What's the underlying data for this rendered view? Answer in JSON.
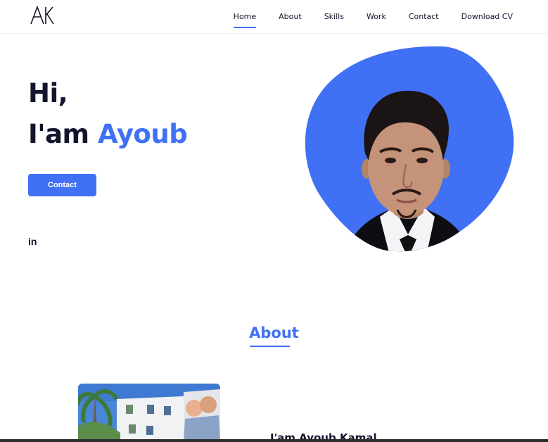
{
  "header": {
    "logo_text": "AK",
    "nav": [
      "Home",
      "About",
      "Skills",
      "Work",
      "Contact",
      "Download CV"
    ],
    "active_nav": "Home"
  },
  "hero": {
    "greeting": "Hi,",
    "name_prefix": "I'am ",
    "name_accent": "Ayoub",
    "contact_button": "Contact",
    "social_linkedin": "in"
  },
  "about": {
    "title": "About",
    "heading": "I'am Ayoub Kamal"
  },
  "colors": {
    "accent": "#4070f4",
    "text": "#12152c"
  }
}
